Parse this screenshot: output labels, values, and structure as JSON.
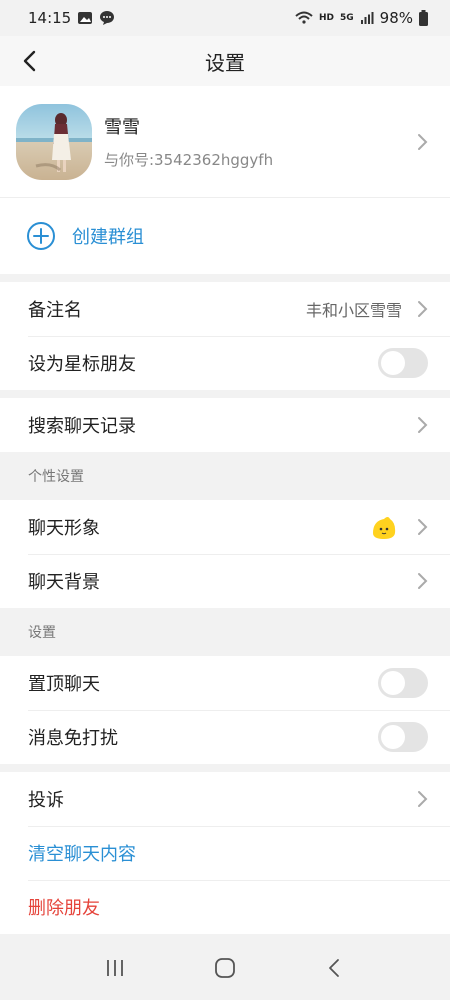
{
  "status": {
    "time": "14:15",
    "battery": "98%",
    "network": "5G",
    "hd": "HD"
  },
  "nav": {
    "title": "设置"
  },
  "profile": {
    "name": "雪雪",
    "id": "与你号:3542362hggyfh"
  },
  "create_group": {
    "label": "创建群组"
  },
  "group1": [
    {
      "label": "备注名",
      "value": "丰和小区雪雪"
    },
    {
      "label": "设为星标朋友",
      "toggle": false
    }
  ],
  "group2": [
    {
      "label": "搜索聊天记录"
    }
  ],
  "section_personal": {
    "title": "个性设置"
  },
  "group3": [
    {
      "label": "聊天形象"
    },
    {
      "label": "聊天背景"
    }
  ],
  "section_settings": {
    "title": "设置"
  },
  "group4": [
    {
      "label": "置顶聊天",
      "toggle": false
    },
    {
      "label": "消息免打扰",
      "toggle": false
    }
  ],
  "group5": [
    {
      "label": "投诉"
    },
    {
      "label": "清空聊天内容"
    },
    {
      "label": "删除朋友"
    }
  ],
  "colors": {
    "accent_blue": "#2a8fd4",
    "danger_red": "#e5433a"
  }
}
